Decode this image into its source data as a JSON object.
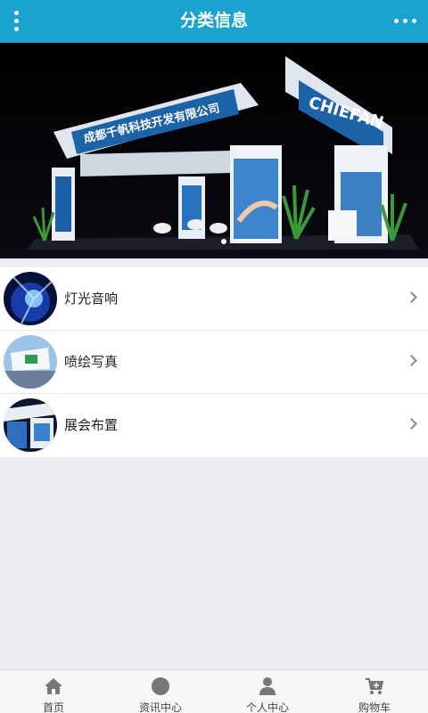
{
  "header": {
    "title": "分类信息",
    "menu_icon": "vertical-dots-icon",
    "more_icon": "horizontal-dots-icon"
  },
  "banner": {
    "company": "成都千帆科技开发有限公司",
    "brand": "CHIEFAN",
    "brand_cn": "千帆",
    "slides": 1
  },
  "categories": [
    {
      "label": "灯光音响",
      "thumb": "stage-lighting"
    },
    {
      "label": "喷绘写真",
      "thumb": "printing"
    },
    {
      "label": "展会布置",
      "thumb": "exhibition-booth"
    }
  ],
  "tabs": [
    {
      "label": "首页",
      "icon": "home-icon"
    },
    {
      "label": "资讯中心",
      "icon": "circle-icon"
    },
    {
      "label": "个人中心",
      "icon": "person-icon"
    },
    {
      "label": "购物车",
      "icon": "cart-icon"
    }
  ],
  "colors": {
    "header": "#1ba3cf",
    "tab_icon": "#777777"
  }
}
